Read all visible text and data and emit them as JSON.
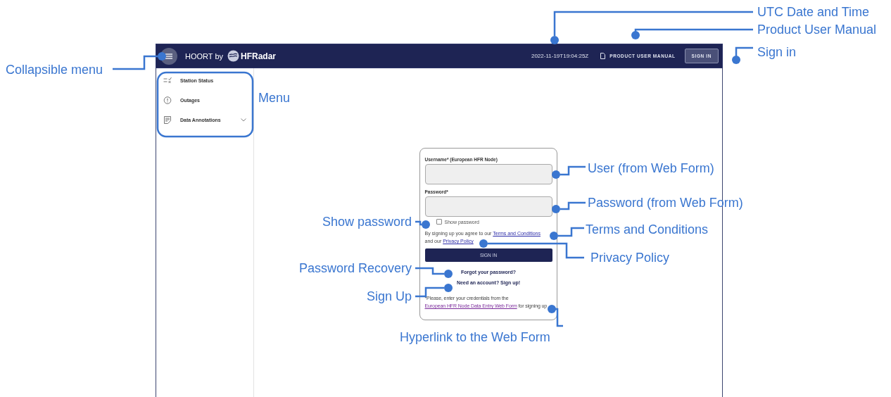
{
  "annotations": [
    {
      "label": "UTC Date and Time"
    },
    {
      "label": "Product User Manual"
    },
    {
      "label": "Sign in"
    },
    {
      "label": "Collapsible menu"
    },
    {
      "label": "Menu"
    },
    {
      "label": "User (from Web Form)"
    },
    {
      "label": "Password (from Web Form)"
    },
    {
      "label": "Show password"
    },
    {
      "label": "Terms and Conditions"
    },
    {
      "label": "Privacy Policy"
    },
    {
      "label": "Password Recovery"
    },
    {
      "label": "Sign Up"
    },
    {
      "label": "Hyperlink to the Web Form"
    }
  ],
  "header": {
    "title": "HOORT by",
    "logo_text": "HFRadar",
    "datetime": "2022-11-19T19:04:25Z",
    "manual_link": "PRODUCT USER MANUAL",
    "sign_in": "SIGN IN"
  },
  "sidebar": {
    "items": [
      {
        "label": "Station Status",
        "kind": "status",
        "expandable": false
      },
      {
        "label": "Outages",
        "kind": "alert",
        "expandable": false
      },
      {
        "label": "Data Annotations",
        "kind": "notes",
        "expandable": true
      }
    ]
  },
  "login": {
    "username_label": "Username* (European HFR Node)",
    "password_label": "Password*",
    "show_password": {
      "label": "Show password",
      "checked": false
    },
    "terms_before": "By signing up you agree to our ",
    "terms_link": "Terms and Conditions",
    "terms_middle": "and our ",
    "privacy_link": "Privacy Policy",
    "submit": "SIGN IN",
    "forgot": "Forgot your password?",
    "signup": "Need an account? Sign up!",
    "note_before": "*Please, enter your credentials from the ",
    "note_link": "European HFR Node Data Entry Web Form",
    "note_after": " for signing up"
  }
}
